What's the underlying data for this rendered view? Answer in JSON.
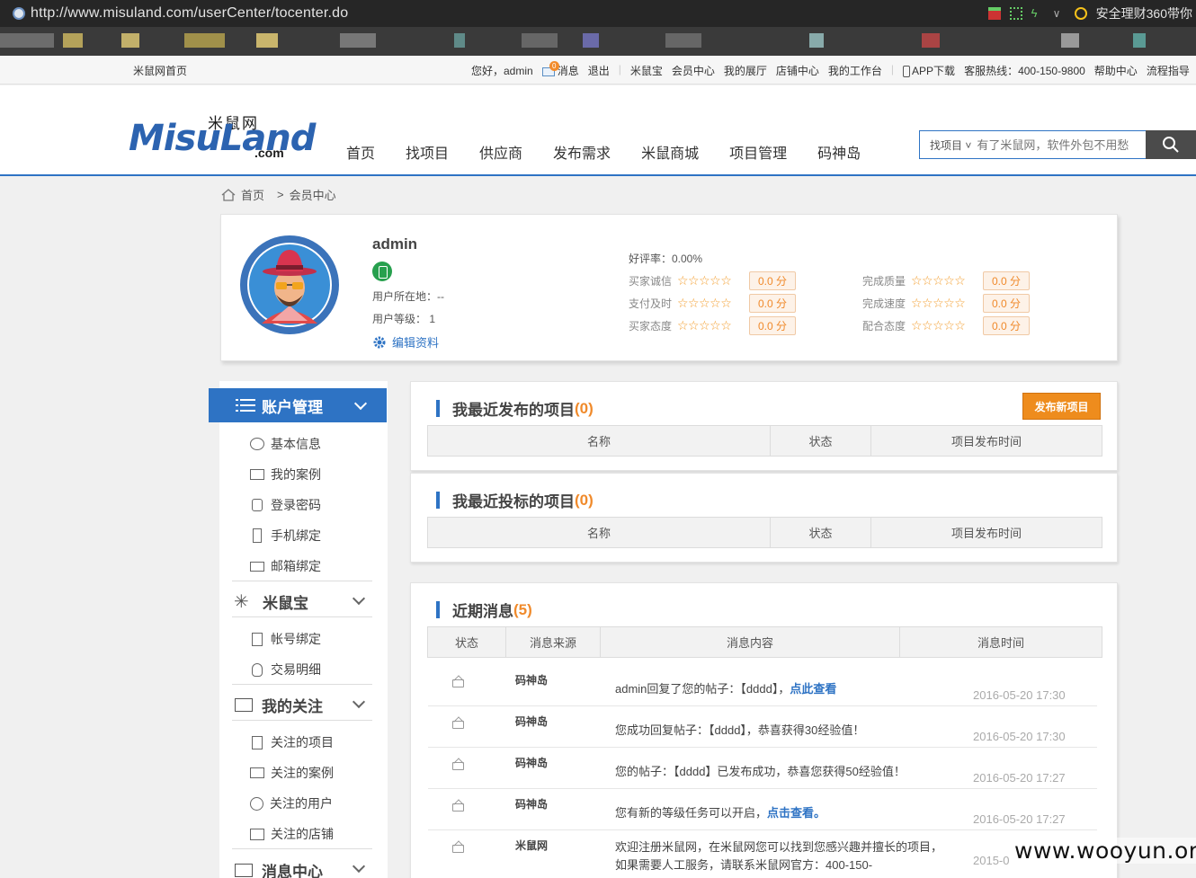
{
  "browser": {
    "url": "http://www.misuland.com/userCenter/tocenter.do",
    "promo_text": "安全理财360带你"
  },
  "topbar": {
    "home": "米鼠网首页",
    "greeting": "您好，admin",
    "msg_count": "0",
    "messages": "消息",
    "logout": "退出",
    "links": [
      "米鼠宝",
      "会员中心",
      "我的展厅",
      "店铺中心",
      "我的工作台"
    ],
    "app": "APP下载",
    "hotline": "客服热线：400-150-9800",
    "help": "帮助中心",
    "flow": "流程指导"
  },
  "header": {
    "logo_cn": "米鼠网",
    "logo_en": "MisuLand",
    "logo_com": ".com",
    "nav": [
      "首页",
      "找项目",
      "供应商",
      "发布需求",
      "米鼠商城",
      "项目管理",
      "码神岛"
    ],
    "search_select": "找项目",
    "search_placeholder": "有了米鼠网，软件外包不用愁"
  },
  "breadcrumb": {
    "home": "首页",
    "sep": ">",
    "current": "会员中心"
  },
  "profile": {
    "username": "admin",
    "location": "用户所在地：--",
    "level": "用户等级：  1",
    "edit": "编辑资料",
    "rating_title": "好评率：0.00%",
    "left_ratings": [
      {
        "label": "买家诚信",
        "score": "0.0 分"
      },
      {
        "label": "支付及时",
        "score": "0.0 分"
      },
      {
        "label": "买家态度",
        "score": "0.0 分"
      }
    ],
    "right_ratings": [
      {
        "label": "完成质量",
        "score": "0.0 分"
      },
      {
        "label": "完成速度",
        "score": "0.0 分"
      },
      {
        "label": "配合态度",
        "score": "0.0 分"
      }
    ],
    "stars": "☆☆☆☆☆"
  },
  "sidebar": {
    "account": "账户管理",
    "account_items": [
      "基本信息",
      "我的案例",
      "登录密码",
      "手机绑定",
      "邮箱绑定"
    ],
    "misubao": "米鼠宝",
    "misubao_items": [
      "帐号绑定",
      "交易明细"
    ],
    "follow": "我的关注",
    "follow_items": [
      "关注的项目",
      "关注的案例",
      "关注的用户",
      "关注的店铺"
    ],
    "message_center": "消息中心"
  },
  "panels": {
    "published": {
      "title": "我最近发布的项目",
      "count": "(0)",
      "button": "发布新项目",
      "columns": [
        "名称",
        "状态",
        "项目发布时间"
      ]
    },
    "bidded": {
      "title": "我最近投标的项目",
      "count": "(0)",
      "columns": [
        "名称",
        "状态",
        "项目发布时间"
      ]
    },
    "recent_messages": {
      "title": "近期消息",
      "count": "(5)",
      "columns": [
        "状态",
        "消息来源",
        "消息内容",
        "消息时间"
      ],
      "rows": [
        {
          "source": "码神岛",
          "text": "admin回复了您的帖子：【dddd】，",
          "link": "点此查看",
          "time": "2016-05-20 17:30"
        },
        {
          "source": "码神岛",
          "text": "您成功回复帖子：【dddd】，恭喜获得30经验值！",
          "link": "",
          "time": "2016-05-20 17:30"
        },
        {
          "source": "码神岛",
          "text": "您的帖子：【dddd】已发布成功，恭喜您获得50经验值！",
          "link": "",
          "time": "2016-05-20 17:27"
        },
        {
          "source": "码神岛",
          "text": "您有新的等级任务可以开启，",
          "link": "点击查看。",
          "time": "2016-05-20 17:27"
        },
        {
          "source": "米鼠网",
          "text": "欢迎注册米鼠网，在米鼠网您可以找到您感兴趣并擅长的项目，如果需要人工服务，请联系米鼠网官方：400-150-",
          "link": "",
          "time": "2015-0"
        }
      ]
    }
  },
  "watermark": "www.wooyun.org",
  "colors": {
    "accent": "#2e73c4",
    "orange": "#ee8c1d",
    "score_bg": "#fdf2e8"
  }
}
